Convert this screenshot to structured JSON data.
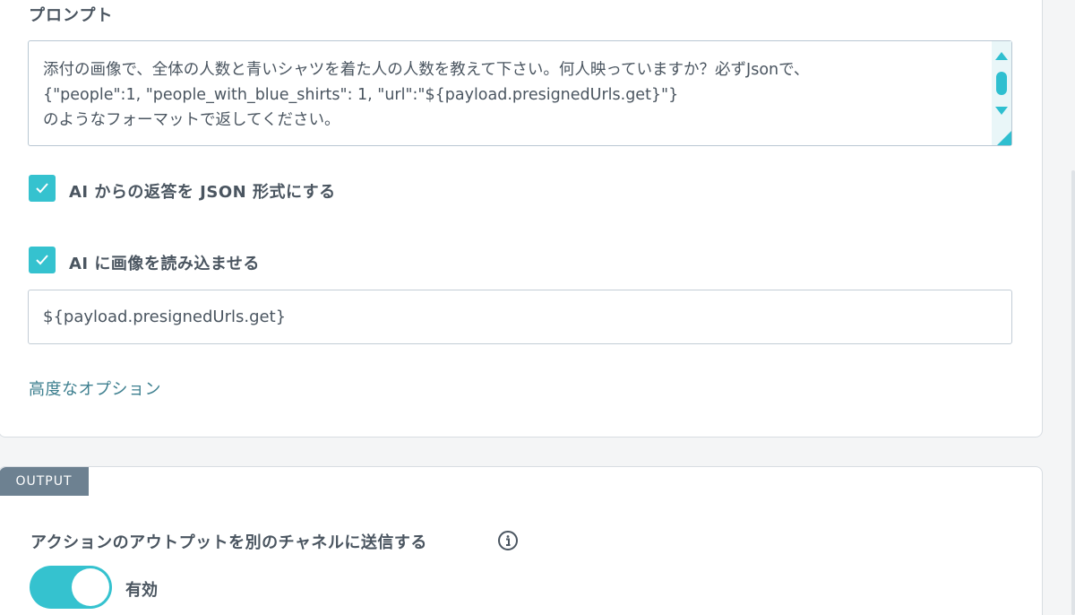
{
  "prompt_section": {
    "title": "プロンプト",
    "prompt_lines": [
      "添付の画像で、全体の人数と青いシャツを着た人の人数を教えて下さい。何人映っていますか？必ずJsonで、",
      "{\"people\":1, \"people_with_blue_shirts\": 1, \"url\":\"${payload.presignedUrls.get}\"}",
      "のようなフォーマットで返してください。"
    ]
  },
  "options": {
    "json_response": {
      "label": "AI からの返答を JSON 形式にする",
      "checked": true
    },
    "load_image": {
      "label": "AI に画像を読み込ませる",
      "checked": true
    },
    "image_url_value": "${payload.presignedUrls.get}",
    "advanced_link": "高度なオプション"
  },
  "output_section": {
    "tag": "OUTPUT",
    "send_label": "アクションのアウトプットを別のチャネルに送信する",
    "toggle_label": "有効",
    "toggle_on": true
  },
  "colors": {
    "accent": "#35c2cf",
    "link": "#3d7f8f",
    "tag_bg": "#6d8191",
    "text": "#4a5560"
  },
  "icons": {
    "check": "check-icon",
    "info": "info-icon",
    "scroll_up": "arrow-up-icon",
    "scroll_down": "arrow-down-icon"
  }
}
